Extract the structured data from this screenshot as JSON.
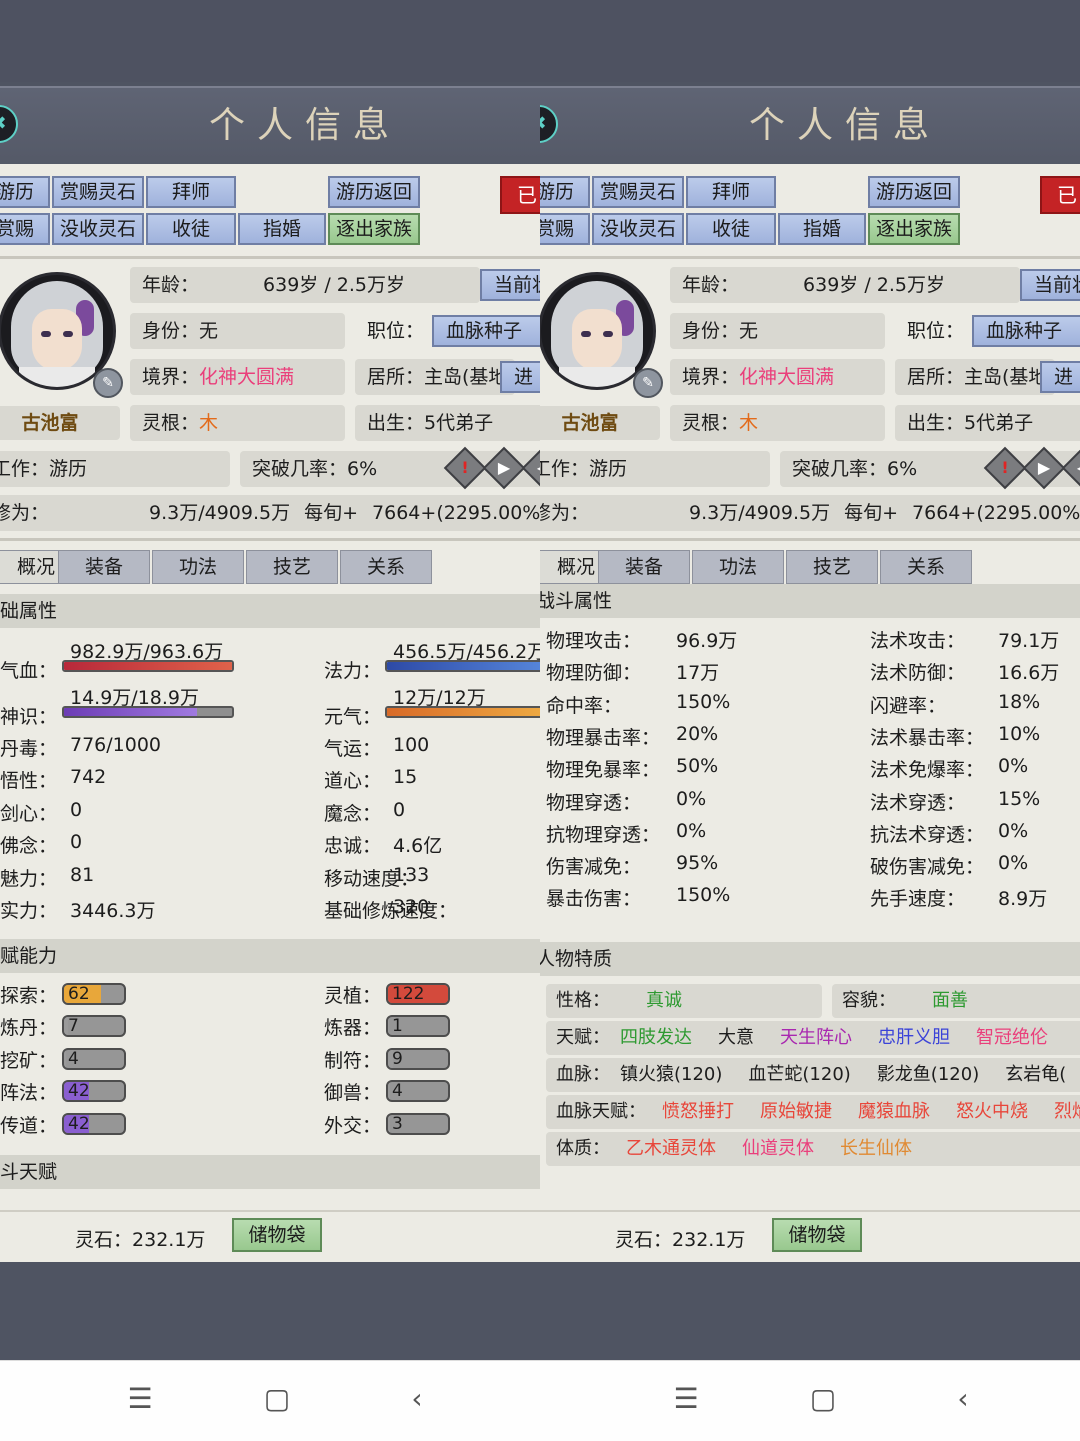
{
  "window": {
    "title": "个人信息"
  },
  "actions": {
    "row1": [
      "游历",
      "赏赐灵石",
      "拜师",
      "游历返回"
    ],
    "row2": [
      "赏赐",
      "没收灵石",
      "收徒",
      "指婚",
      "逐出家族"
    ],
    "seal": "已"
  },
  "profile": {
    "name": "古池富",
    "age_label": "年龄：",
    "age_value": "639岁 / 2.5万岁",
    "status_button": "当前状",
    "identity_label": "身份：",
    "identity_value": "无",
    "position_label": "职位：",
    "position_value": "血脉种子",
    "realm_label": "境界：",
    "realm_value": "化神大圆满",
    "residence_label": "居所：",
    "residence_value": "主岛(基地",
    "enter_button": "进",
    "root_label": "灵根：",
    "root_value": "木",
    "birth_label": "出生：",
    "birth_value": "5代弟子",
    "work_label": "工作：",
    "work_value": "游历",
    "breakthrough_label": "突破几率：",
    "breakthrough_value": "6%",
    "cultivation_label": "修为：",
    "cultivation_value": "9.3万/4909.5万",
    "per_turn_label": "每旬+",
    "per_turn_value": "7664+(2295.00%)"
  },
  "tabs": [
    "概况",
    "装备",
    "功法",
    "技艺",
    "关系"
  ],
  "left": {
    "section_basic": "础属性",
    "hp_label": "气血：",
    "hp_value": "982.9万/963.6万",
    "hp_fill": 1.0,
    "mana_label": "法力：",
    "mana_value": "456.5万/456.2万",
    "mana_fill": 1.0,
    "sense_label": "神识：",
    "sense_value": "14.9万/18.9万",
    "sense_fill": 0.79,
    "yuan_label": "元气：",
    "yuan_value": "12万/12万",
    "yuan_fill": 1.0,
    "basic_stats_left": [
      {
        "label": "丹毒：",
        "value": "776/1000"
      },
      {
        "label": "悟性：",
        "value": "742"
      },
      {
        "label": "剑心：",
        "value": "0"
      },
      {
        "label": "佛念：",
        "value": "0"
      },
      {
        "label": "魅力：",
        "value": "81"
      },
      {
        "label": "实力：",
        "value": "3446.3万"
      }
    ],
    "basic_stats_right": [
      {
        "label": "气运：",
        "value": "100"
      },
      {
        "label": "道心：",
        "value": "15"
      },
      {
        "label": "魔念：",
        "value": "0"
      },
      {
        "label": "忠诚：",
        "value": "4.6亿"
      },
      {
        "label": "移动速度：",
        "value": "133"
      },
      {
        "label": "基础修炼速度：",
        "value": "320"
      }
    ],
    "section_talent": "赋能力",
    "talent_left": [
      {
        "label": "探索：",
        "value": "62",
        "color": "#e8a73a",
        "fill": 0.62
      },
      {
        "label": "炼丹：",
        "value": "7",
        "color": "#9a9a9a",
        "fill": 0.07
      },
      {
        "label": "挖矿：",
        "value": "4",
        "color": "#9a9a9a",
        "fill": 0.04
      },
      {
        "label": "阵法：",
        "value": "42",
        "color": "#8a5fd0",
        "fill": 0.42
      },
      {
        "label": "传道：",
        "value": "42",
        "color": "#8a5fd0",
        "fill": 0.42
      }
    ],
    "talent_right": [
      {
        "label": "灵植：",
        "value": "122",
        "color": "#d34a3c",
        "fill": 1.0
      },
      {
        "label": "炼器：",
        "value": "1",
        "color": "#9a9a9a",
        "fill": 0.01
      },
      {
        "label": "制符：",
        "value": "9",
        "color": "#9a9a9a",
        "fill": 0.09
      },
      {
        "label": "御兽：",
        "value": "4",
        "color": "#9a9a9a",
        "fill": 0.04
      },
      {
        "label": "外交：",
        "value": "3",
        "color": "#9a9a9a",
        "fill": 0.03
      }
    ],
    "section_combat_talent": "斗天赋"
  },
  "right": {
    "section_combat": "战斗属性",
    "combat_left": [
      {
        "label": "物理攻击：",
        "value": "96.9万"
      },
      {
        "label": "物理防御：",
        "value": "17万"
      },
      {
        "label": "命中率：",
        "value": "150%"
      },
      {
        "label": "物理暴击率：",
        "value": "20%"
      },
      {
        "label": "物理免暴率：",
        "value": "50%"
      },
      {
        "label": "物理穿透：",
        "value": "0%"
      },
      {
        "label": "抗物理穿透：",
        "value": "0%"
      },
      {
        "label": "伤害减免：",
        "value": "95%"
      },
      {
        "label": "暴击伤害：",
        "value": "150%"
      }
    ],
    "combat_right": [
      {
        "label": "法术攻击：",
        "value": "79.1万"
      },
      {
        "label": "法术防御：",
        "value": "16.6万"
      },
      {
        "label": "闪避率：",
        "value": "18%"
      },
      {
        "label": "法术暴击率：",
        "value": "10%"
      },
      {
        "label": "法术免爆率：",
        "value": "0%"
      },
      {
        "label": "法术穿透：",
        "value": "15%"
      },
      {
        "label": "抗法术穿透：",
        "value": "0%"
      },
      {
        "label": "破伤害减免：",
        "value": "0%"
      },
      {
        "label": "先手速度：",
        "value": "8.9万"
      }
    ],
    "section_traits": "人物特质",
    "personality_label": "性格：",
    "personality_value": "真诚",
    "looks_label": "容貌：",
    "looks_value": "面善",
    "gift_label": "天赋：",
    "gifts": [
      {
        "text": "四肢发达",
        "color": "#2e9a31"
      },
      {
        "text": "大意",
        "color": "#1d1d1d"
      },
      {
        "text": "天生阵心",
        "color": "#a928b0"
      },
      {
        "text": "忠肝义胆",
        "color": "#3b43d8"
      },
      {
        "text": "智冠绝伦",
        "color": "#ea3f7b"
      }
    ],
    "blood_label": "血脉：",
    "bloodlines": [
      "镇火猿(120)",
      "血芒蛇(120)",
      "影龙鱼(120)",
      "玄岩龟("
    ],
    "blood_gift_label": "血脉天赋：",
    "blood_gifts": [
      "愤怒捶打",
      "原始敏捷",
      "魔猿血脉",
      "怒火中烧",
      "烈焰"
    ],
    "body_label": "体质：",
    "bodies": [
      {
        "text": "乙木通灵体",
        "color": "#e8463a"
      },
      {
        "text": "仙道灵体",
        "color": "#ea3f7b"
      },
      {
        "text": "长生仙体",
        "color": "#e08a33"
      }
    ]
  },
  "footer": {
    "stones_label": "灵石：",
    "stones_value": "232.1万",
    "bag_button": "储物袋"
  },
  "system_nav": {
    "menu": "☰",
    "home": "▢",
    "back": "‹"
  }
}
